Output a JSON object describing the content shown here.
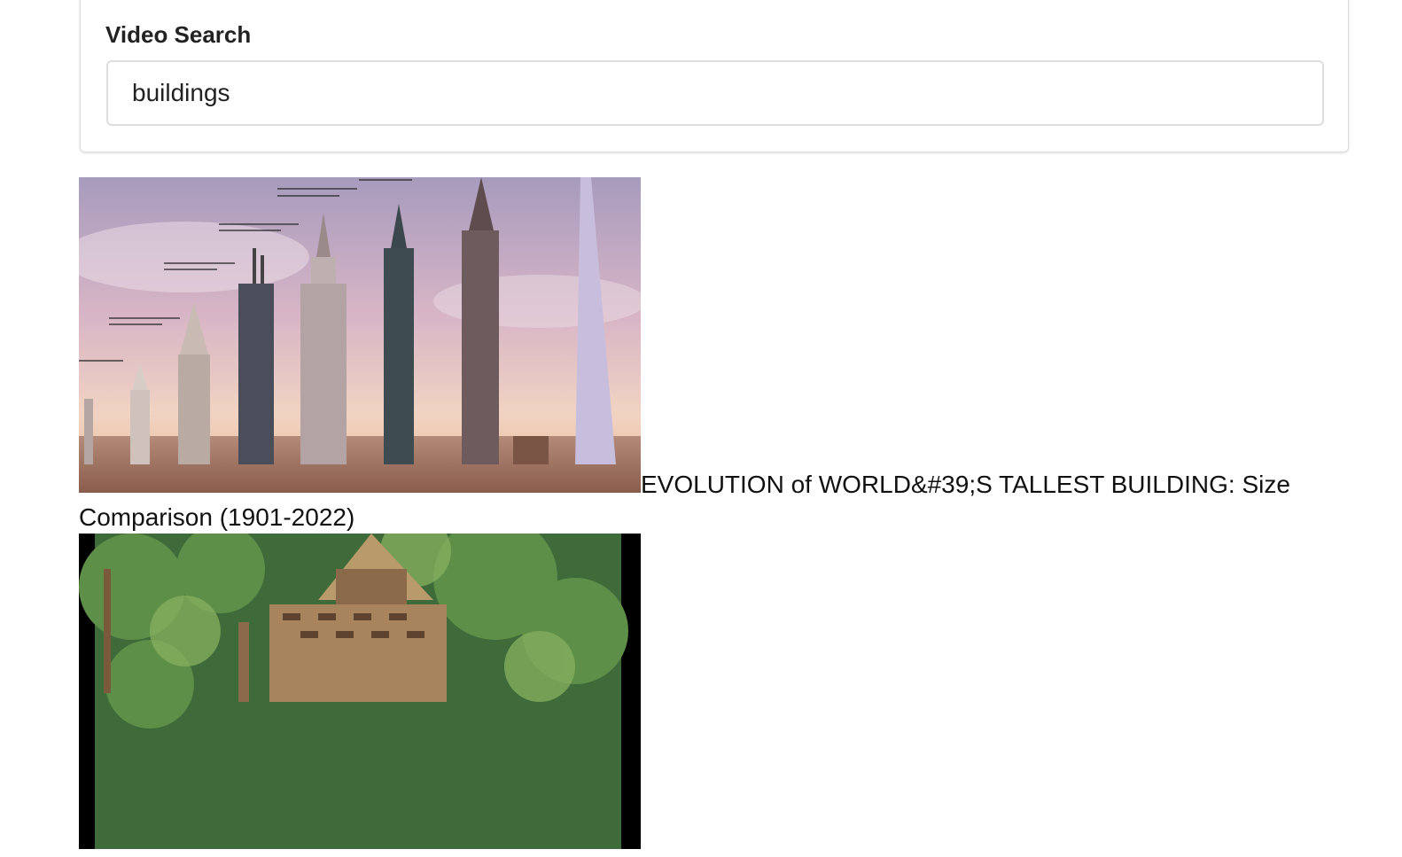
{
  "search": {
    "label": "Video Search",
    "value": "buildings",
    "placeholder": ""
  },
  "results": [
    {
      "title": "EVOLUTION of WORLD&#39;S TALLEST BUILDING: Size Comparison (1901-2022)",
      "thumbnail_icon": "skyscraper-comparison-image"
    },
    {
      "title": "",
      "thumbnail_icon": "brick-hut-in-forest-image"
    }
  ]
}
